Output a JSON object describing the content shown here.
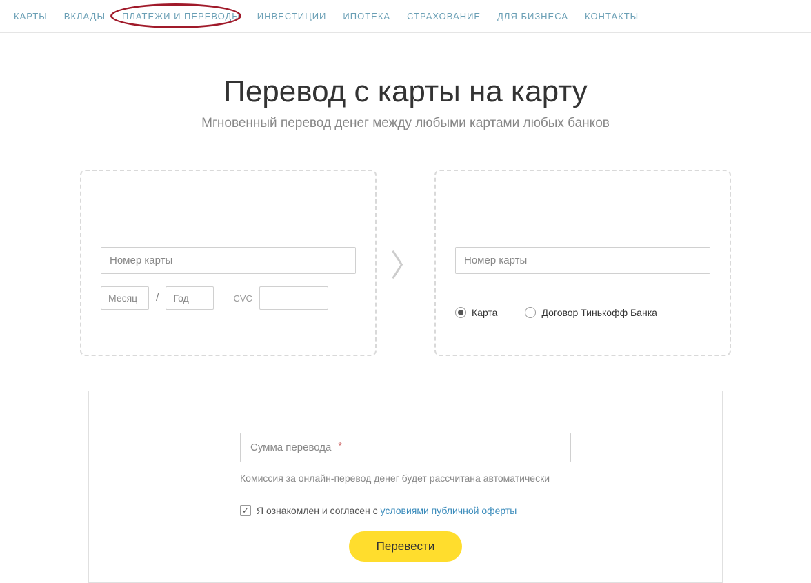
{
  "nav": {
    "items": [
      "КАРТЫ",
      "ВКЛАДЫ",
      "ПЛАТЕЖИ И ПЕРЕВОДЫ",
      "ИНВЕСТИЦИИ",
      "ИПОТЕКА",
      "СТРАХОВАНИЕ",
      "ДЛЯ БИЗНЕСА",
      "КОНТАКТЫ"
    ]
  },
  "hero": {
    "title": "Перевод с карты на карту",
    "subtitle": "Мгновенный перевод денег между любыми картами любых банков"
  },
  "from": {
    "card_placeholder": "Номер карты",
    "month_placeholder": "Месяц",
    "year_placeholder": "Год",
    "cvc_label": "CVC",
    "cvc_dash": "—"
  },
  "to": {
    "card_placeholder": "Номер карты",
    "option_card": "Карта",
    "option_contract": "Договор Тинькофф Банка"
  },
  "bottom": {
    "amount_placeholder": "Сумма перевода",
    "asterisk": "*",
    "fee_note": "Комиссия за онлайн-перевод денег будет рассчитана автоматически",
    "consent_prefix": "Я ознакомлен и согласен с ",
    "consent_link": "условиями публичной оферты",
    "submit": "Перевести"
  }
}
